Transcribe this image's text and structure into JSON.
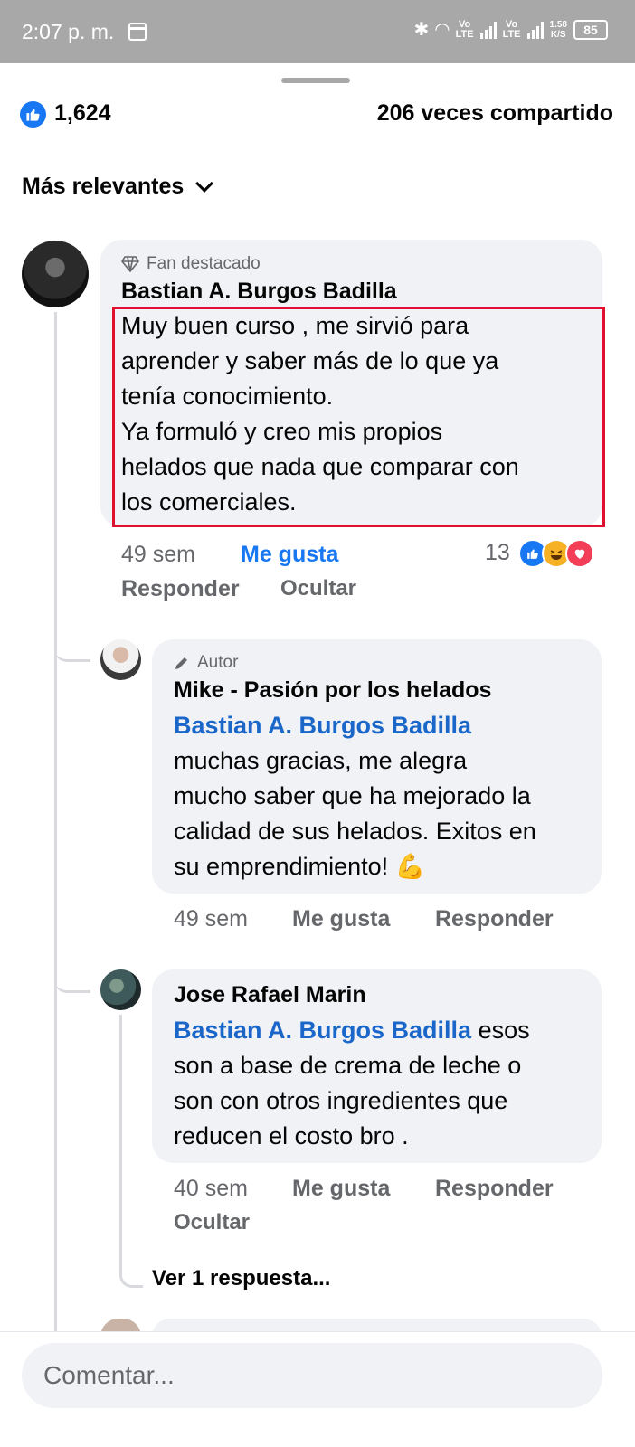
{
  "status_bar": {
    "time": "2:07 p. m.",
    "network_speed": "1.58\nK/S",
    "battery": "85",
    "vo_label": "Vo\nLTE"
  },
  "reactions_summary": {
    "likes": "1,624",
    "shares": "206 veces compartido"
  },
  "sort": {
    "label": "Más relevantes"
  },
  "comments": [
    {
      "badge": "Fan destacado",
      "author": "Bastian A. Burgos Badilla",
      "text": "Muy buen curso , me sirvió para\naprender y saber más de lo que ya\ntenía conocimiento.\nYa formuló y creo mis propios\nhelados que nada que comparar con\nlos comerciales.",
      "time": "49 sem",
      "like_label": "Me gusta",
      "reply_label": "Responder",
      "hide_label": "Ocultar",
      "reaction_count": "13",
      "reaction_icons": [
        "like-icon",
        "haha-icon",
        "love-icon"
      ]
    }
  ],
  "replies": [
    {
      "badge": "Autor",
      "author": "Mike - Pasión por los helados",
      "mention": "Bastian A. Burgos Badilla",
      "text": "muchas gracias, me alegra\nmucho saber que ha mejorado la\ncalidad de sus helados. Exitos en\nsu emprendimiento! 💪",
      "time": "49 sem",
      "like_label": "Me gusta",
      "reply_label": "Responder"
    },
    {
      "author": "Jose Rafael Marin",
      "mention": "Bastian A. Burgos Badilla",
      "text_after_mention": " esos",
      "text": "son a base de crema de leche o\nson con otros ingredientes que\nreducen el costo bro .",
      "time": "40 sem",
      "like_label": "Me gusta",
      "reply_label": "Responder",
      "hide_label": "Ocultar"
    }
  ],
  "more_replies": "Ver 1 respuesta...",
  "comment_box": {
    "placeholder": "Comentar..."
  }
}
